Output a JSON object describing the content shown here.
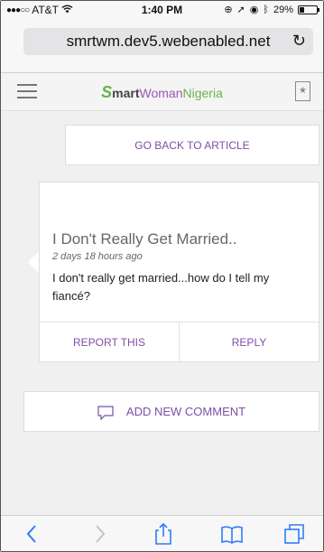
{
  "status_bar": {
    "carrier": "AT&T",
    "time": "1:40 PM",
    "battery_percent": "29%",
    "battery_level": 0.29
  },
  "browser": {
    "url": "smrtwm.dev5.webenabled.net"
  },
  "site": {
    "logo_letter": "S",
    "logo_smart": "mart",
    "logo_woman": "Woman",
    "logo_nigeria": "Nigeria"
  },
  "go_back_label": "GO BACK TO ARTICLE",
  "comment": {
    "title": "I Don't Really Get Married..",
    "time_ago": "2 days 18 hours ago",
    "body": "I don't really get married...how do I tell my fiancé?",
    "report_label": "REPORT THIS",
    "reply_label": "REPLY"
  },
  "add_comment_label": "ADD NEW COMMENT",
  "colors": {
    "accent": "#7d4fa6",
    "brand_green": "#6ab04c",
    "ios_blue": "#2f7df6"
  },
  "icons": [
    "wifi-icon",
    "location-icon",
    "bluetooth-icon",
    "reload-icon",
    "hamburger-icon",
    "bookmark-icon",
    "chat-icon",
    "back-icon",
    "forward-icon",
    "share-icon",
    "bookmarks-icon",
    "tabs-icon"
  ]
}
